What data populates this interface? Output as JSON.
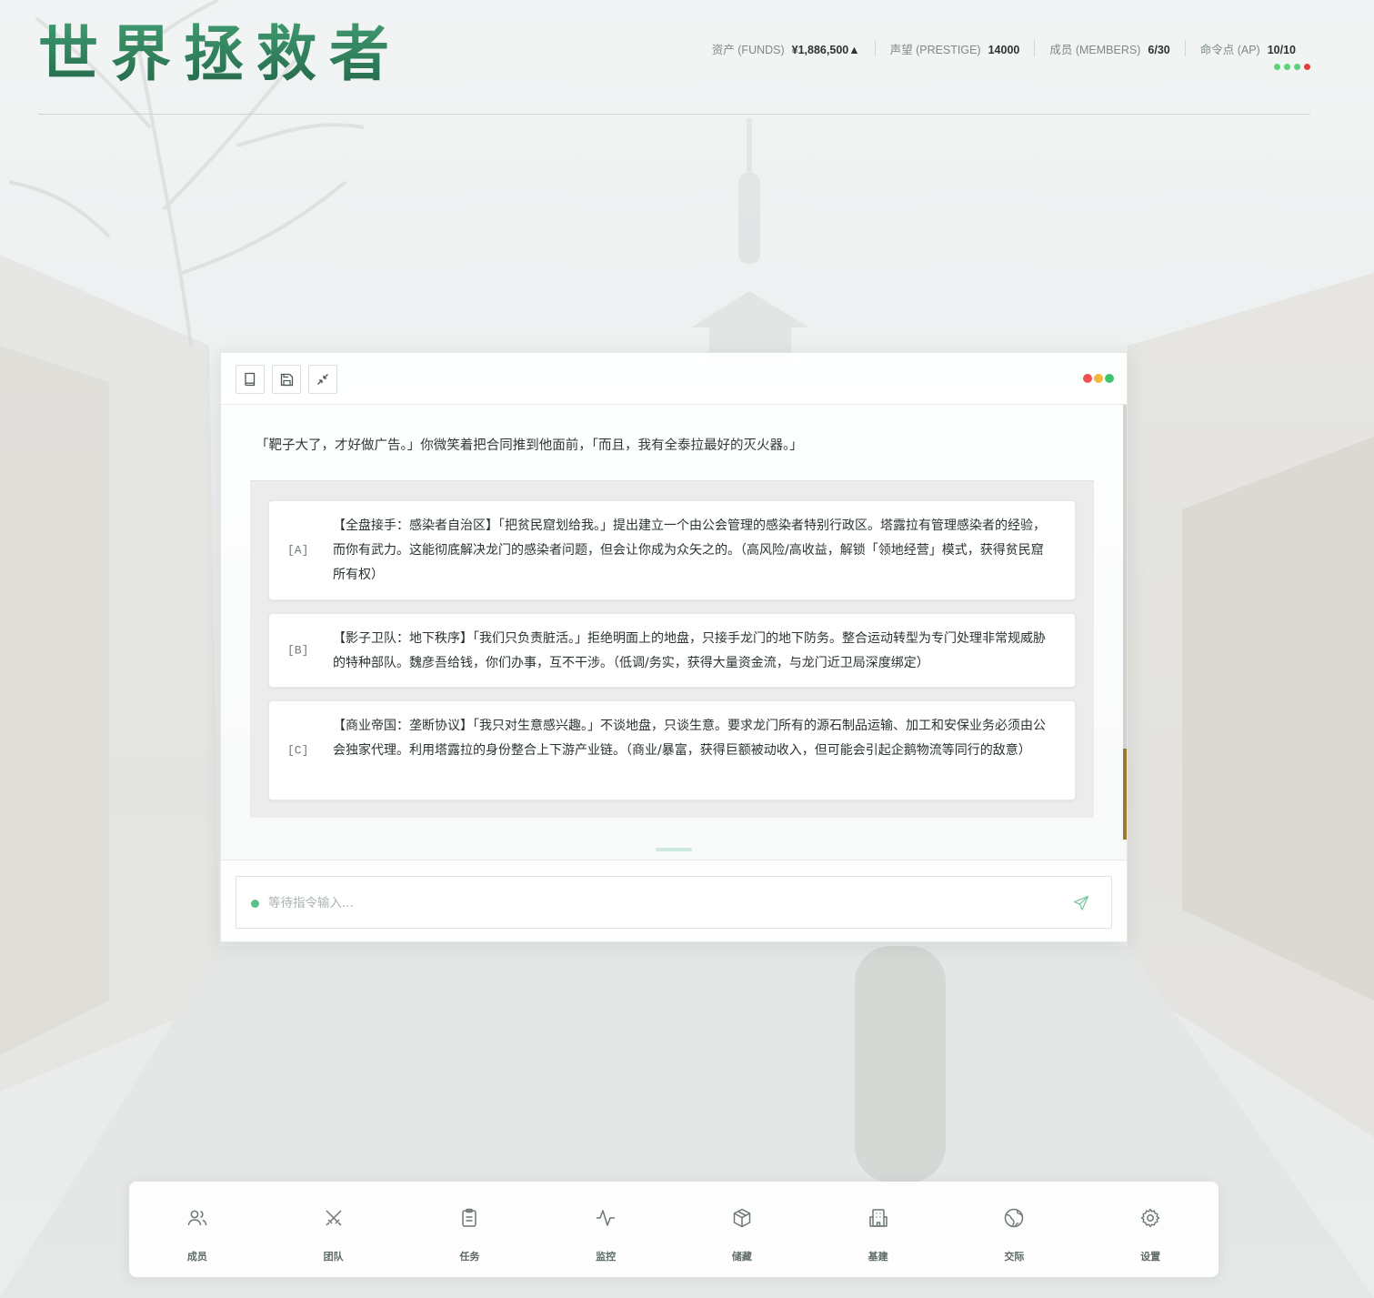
{
  "app": {
    "title": "世界拯救者"
  },
  "stats": [
    {
      "label": "资产 (FUNDS)",
      "value": "¥1,886,500▲"
    },
    {
      "label": "声望 (PRESTIGE)",
      "value": "14000"
    },
    {
      "label": "成员 (MEMBERS)",
      "value": "6/30"
    },
    {
      "label": "命令点 (AP)",
      "value": "10/10"
    }
  ],
  "ap_indicator_colors": [
    "#5cd37a",
    "#5cd37a",
    "#5cd37a",
    "#e0413a"
  ],
  "window": {
    "toolbar": [
      {
        "name": "book-icon",
        "label": "log"
      },
      {
        "name": "save-icon",
        "label": "save"
      },
      {
        "name": "minimize-icon",
        "label": "collapse"
      }
    ],
    "traffic_lights": [
      "#f0524e",
      "#f4b63d",
      "#3fc46a"
    ],
    "narrative": "「靶子大了，才好做广告。」你微笑着把合同推到他面前，「而且，我有全泰拉最好的灭火器。」",
    "choices": [
      {
        "key": "[A]",
        "text": "【全盘接手：感染者自治区】「把贫民窟划给我。」提出建立一个由公会管理的感染者特别行政区。塔露拉有管理感染者的经验，而你有武力。这能彻底解决龙门的感染者问题，但会让你成为众矢之的。（高风险/高收益，解锁「领地经营」模式，获得贫民窟所有权）"
      },
      {
        "key": "[B]",
        "text": "【影子卫队：地下秩序】「我们只负责脏活。」拒绝明面上的地盘，只接手龙门的地下防务。整合运动转型为专门处理非常规威胁的特种部队。魏彦吾给钱，你们办事，互不干涉。（低调/务实，获得大量资金流，与龙门近卫局深度绑定）"
      },
      {
        "key": "[C]",
        "text": "【商业帝国：垄断协议】「我只对生意感兴趣。」不谈地盘，只谈生意。要求龙门所有的源石制品运输、加工和安保业务必须由公会独家代理。利用塔露拉的身份整合上下游产业链。（商业/暴富，获得巨额被动收入，但可能会引起企鹅物流等同行的敌意）"
      }
    ],
    "input": {
      "placeholder": "等待指令输入..."
    }
  },
  "nav": [
    {
      "icon": "users-icon",
      "label": "成员"
    },
    {
      "icon": "crossed-swords-icon",
      "label": "团队"
    },
    {
      "icon": "clipboard-icon",
      "label": "任务"
    },
    {
      "icon": "activity-icon",
      "label": "监控"
    },
    {
      "icon": "box-icon",
      "label": "储藏"
    },
    {
      "icon": "building-icon",
      "label": "基建"
    },
    {
      "icon": "globe-icon",
      "label": "交际"
    },
    {
      "icon": "gear-icon",
      "label": "设置"
    }
  ]
}
